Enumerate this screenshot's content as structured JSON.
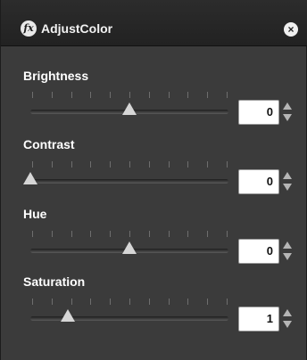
{
  "panel": {
    "icon_text": "fx",
    "title": "AdjustColor",
    "close_icon": "×"
  },
  "properties": [
    {
      "label": "Brightness",
      "value": "0",
      "level": 0.5
    },
    {
      "label": "Contrast",
      "value": "0",
      "level": 0.0
    },
    {
      "label": "Hue",
      "value": "0",
      "level": 0.5
    },
    {
      "label": "Saturation",
      "value": "1",
      "level": 0.19
    }
  ]
}
